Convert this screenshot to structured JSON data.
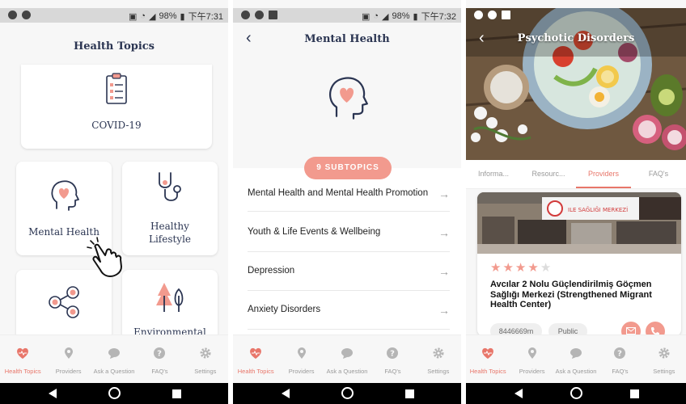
{
  "status_bar": [
    {
      "battery": "98%",
      "time": "下午7:31"
    },
    {
      "battery": "98%",
      "time": "下午7:32"
    }
  ],
  "tabbar": {
    "items": [
      {
        "label": "Health Topics",
        "icon": "heart-pulse-icon"
      },
      {
        "label": "Providers",
        "icon": "map-pin-icon"
      },
      {
        "label": "Ask a Question",
        "icon": "chat-bubble-icon"
      },
      {
        "label": "FAQ's",
        "icon": "question-icon"
      },
      {
        "label": "Settings",
        "icon": "gear-icon"
      }
    ],
    "active_color": "#e8766a",
    "inactive_color": "#9a9a9a"
  },
  "screen1": {
    "title": "Health Topics",
    "cards": [
      {
        "label": "COVID-19",
        "icon": "clipboard-checklist-icon"
      },
      {
        "label": "Mental Health",
        "icon": "head-heart-icon"
      },
      {
        "label": "Healthy Lifestyle",
        "icon": "stethoscope-icon"
      },
      {
        "label": "",
        "icon": "share-network-icon"
      },
      {
        "label": "Environmental",
        "icon": "trees-icon"
      }
    ]
  },
  "screen2": {
    "title": "Mental Health",
    "subtopics_label": "9 SUBTOPICS",
    "items": [
      "Mental Health and Mental Health Promotion",
      "Youth & Life Events & Wellbeing",
      "Depression",
      "Anxiety Disorders"
    ]
  },
  "screen3": {
    "title": "Psychotic Disorders",
    "tabs": [
      "Informa...",
      "Resourc...",
      "Providers",
      "FAQ's"
    ],
    "active_tab": "Providers",
    "provider": {
      "rating": 4,
      "max_rating": 5,
      "name": "Avcılar 2 Nolu Güçlendirilmiş Göçmen Sağlığı Merkezi (Strengthened Migrant Health Center)",
      "phone_chip": "8446669m",
      "type_chip": "Public",
      "sign_text": "ILE SAĞLIĞI MERKEZİ"
    }
  },
  "colors": {
    "accent": "#e8766a",
    "pill": "#f29a8e",
    "navy": "#2b3552"
  }
}
